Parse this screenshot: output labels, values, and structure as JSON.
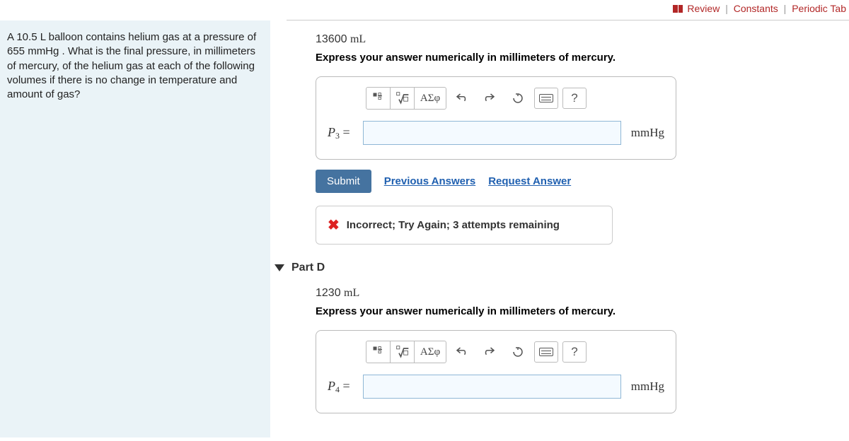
{
  "topnav": {
    "review": "Review",
    "constants": "Constants",
    "periodic": "Periodic Tab"
  },
  "question": {
    "text": "A 10.5 L balloon contains helium gas at a pressure of 655 mmHg . What is the final pressure, in millimeters of mercury, of the helium gas at each of the following volumes if there is no change in temperature and amount of gas?"
  },
  "partC": {
    "given_value": "13600",
    "given_units": "mL",
    "instruction": "Express your answer numerically in millimeters of mercury.",
    "var_name": "P",
    "var_sub": "3",
    "equals": " = ",
    "answer": "",
    "unit": "mmHg",
    "submit": "Submit",
    "prev_answers": "Previous Answers",
    "request_answer": "Request Answer",
    "feedback": "Incorrect; Try Again; 3 attempts remaining"
  },
  "partD": {
    "title": "Part D",
    "given_value": "1230",
    "given_units": "mL",
    "instruction": "Express your answer numerically in millimeters of mercury.",
    "var_name": "P",
    "var_sub": "4",
    "equals": " = ",
    "answer": "",
    "unit": "mmHg"
  },
  "toolbar": {
    "greek": "ΑΣφ",
    "help": "?"
  }
}
